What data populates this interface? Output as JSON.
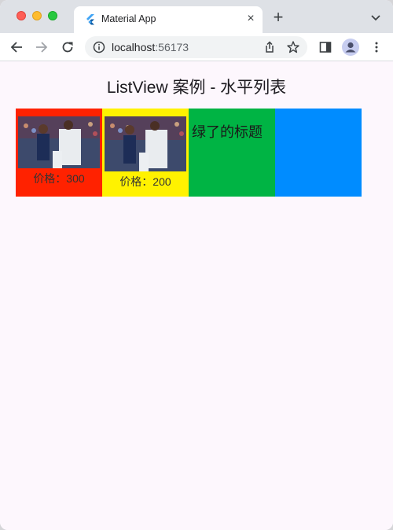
{
  "browser": {
    "tab_title": "Material App",
    "tab_close": "×",
    "new_tab": "+",
    "url_host": "localhost",
    "url_port": ":56173"
  },
  "app": {
    "title": "ListView 案例 - 水平列表",
    "items": [
      {
        "color": "#ff2200",
        "kind": "image-card",
        "price_label": "价格：300"
      },
      {
        "color": "#fff200",
        "kind": "image-card",
        "price_label": "价格：200"
      },
      {
        "color": "#00b444",
        "kind": "text",
        "label": "绿了的标题"
      },
      {
        "color": "#008cff",
        "kind": "empty"
      }
    ]
  },
  "colors": {
    "page_bg": "#fdf7fd",
    "red": "#ff2200",
    "yellow": "#fff200",
    "green": "#00b444",
    "blue": "#008cff"
  },
  "icons": [
    "flutter-logo-icon",
    "back-arrow-icon",
    "forward-arrow-icon",
    "reload-icon",
    "info-icon",
    "share-icon",
    "star-icon",
    "side-panel-icon",
    "profile-icon",
    "more-vert-icon",
    "tab-search-icon"
  ]
}
